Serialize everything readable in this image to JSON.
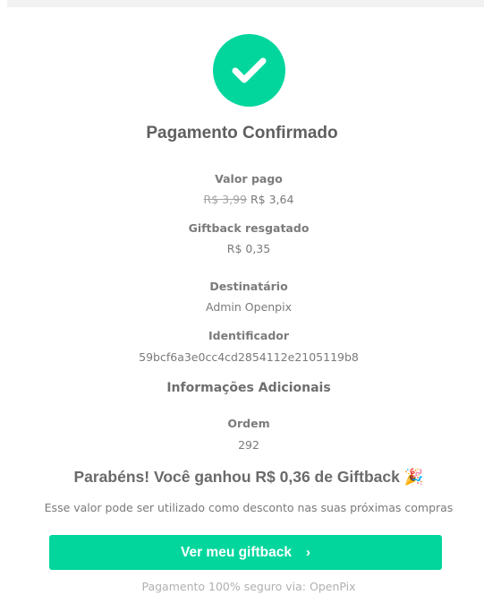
{
  "header": {
    "title": "Pagamento Confirmado"
  },
  "payment": {
    "valor_label": "Valor pago",
    "valor_original": "R$ 3,99",
    "valor_pago": "R$ 3,64",
    "giftback_label": "Giftback resgatado",
    "giftback_value": "R$ 0,35",
    "destinatario_label": "Destinatário",
    "destinatario_value": "Admin Openpix",
    "identificador_label": "Identificador",
    "identificador_value": "59bcf6a3e0cc4cd2854112e2105119b8"
  },
  "additional": {
    "section_title": "Informações Adicionais",
    "ordem_label": "Ordem",
    "ordem_value": "292"
  },
  "giftback": {
    "congrats": "Parabéns! Você ganhou R$ 0,36 de Giftback",
    "emoji": "🎉",
    "description": "Esse valor pode ser utilizado como desconto nas suas próximas compras",
    "button_label": "Ver meu giftback"
  },
  "footer": {
    "text": "Pagamento 100% seguro via: OpenPix"
  },
  "colors": {
    "accent": "#03d69d",
    "text": "#6b6b6b",
    "muted": "#a4a4a4"
  },
  "icons": {
    "status": "check-icon",
    "button": "chevron-right-icon"
  }
}
